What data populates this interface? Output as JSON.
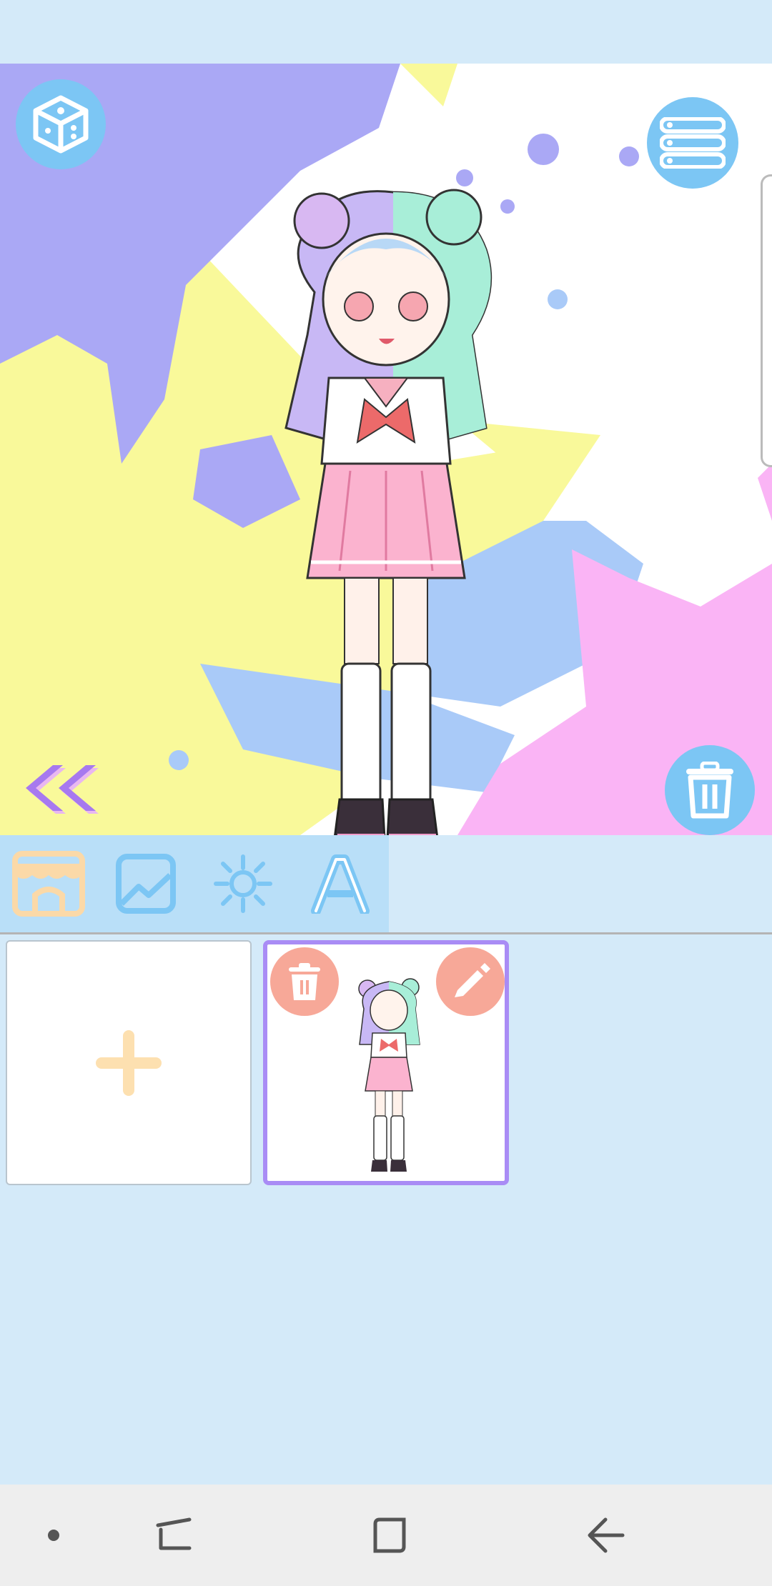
{
  "canvas": {
    "colors": {
      "purple_splash": "#aaa8f5",
      "yellow_splash": "#f9f99a",
      "blue_splash": "#a9caf8",
      "pink_splash": "#fab4f5",
      "button": "#7cc6f4"
    },
    "buttons": {
      "random": "dice-icon",
      "menu": "list-icon",
      "delete": "trash-icon",
      "back": "double-chevron-left-icon"
    }
  },
  "toolbar": {
    "tabs": [
      {
        "name": "shop",
        "icon": "shop-icon"
      },
      {
        "name": "background",
        "icon": "image-icon"
      },
      {
        "name": "effects",
        "icon": "splash-icon"
      },
      {
        "name": "text",
        "icon": "letter-a-icon"
      }
    ],
    "text_tab_glyph": "A"
  },
  "gallery": {
    "add_icon": "plus-icon",
    "saved_card": {
      "delete_icon": "trash-icon",
      "edit_icon": "pencil-icon"
    },
    "colors": {
      "card_border": "#a98cf5",
      "card_button": "#f7a898",
      "plus": "#fde0b0"
    }
  },
  "navbar": {
    "items": [
      "recent-dot",
      "recents-icon",
      "home-icon",
      "back-icon"
    ]
  }
}
